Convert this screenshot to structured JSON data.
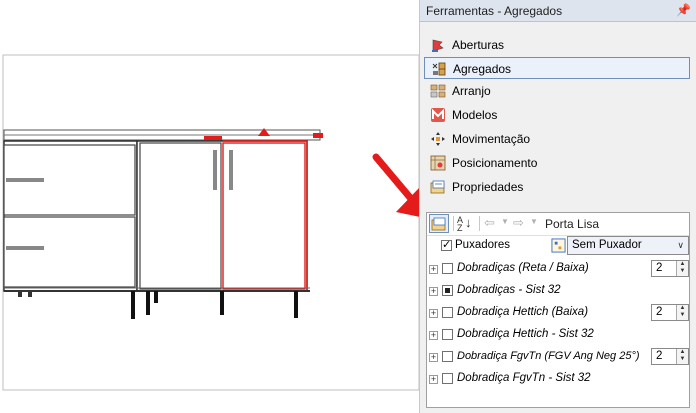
{
  "panel": {
    "title": "Ferramentas - Agregados",
    "pin_icon": "pin-icon",
    "menu": [
      {
        "label": "Aberturas",
        "icon": "aberturas-icon"
      },
      {
        "label": "Agregados",
        "icon": "agregados-icon",
        "selected": true
      },
      {
        "label": "Arranjo",
        "icon": "arranjo-icon"
      },
      {
        "label": "Modelos",
        "icon": "modelos-icon"
      },
      {
        "label": "Movimentação",
        "icon": "move-icon"
      },
      {
        "label": "Posicionamento",
        "icon": "posicionamento-icon"
      },
      {
        "label": "Propriedades",
        "icon": "propriedades-icon"
      }
    ]
  },
  "properties": {
    "toolbar_title": "Porta Lisa",
    "puxadores": {
      "label": "Puxadores",
      "checked": true,
      "select_value": "Sem Puxador"
    },
    "rows": [
      {
        "label": "Dobradiças (Reta / Baixa)",
        "state": "unchecked",
        "value": "2"
      },
      {
        "label": "Dobradiças - Sist 32",
        "state": "indeterminate"
      },
      {
        "label": "Dobradiça Hettich (Baixa)",
        "state": "unchecked",
        "value": "2"
      },
      {
        "label": "Dobradiça Hettich - Sist 32",
        "state": "unchecked"
      },
      {
        "label": "Dobradiça FgvTn (FGV Ang Neg 25°)",
        "state": "unchecked",
        "value": "2"
      },
      {
        "label": "Dobradiça FgvTn - Sist 32",
        "state": "unchecked"
      }
    ]
  },
  "colors": {
    "accent_red": "#e41b1b",
    "selection_border": "#6f8fb8"
  }
}
